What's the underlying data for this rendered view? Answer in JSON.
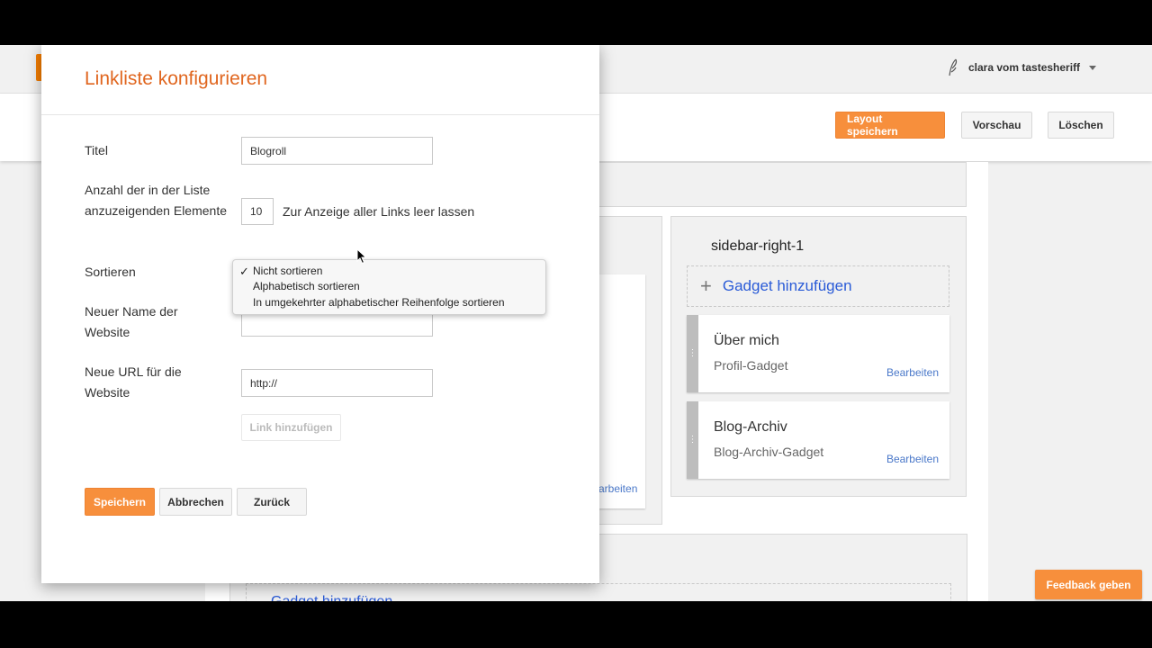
{
  "topbar": {
    "account_name": "clara vom tastesheriff",
    "account_icon": "quill-icon"
  },
  "header": {
    "save_layout_label": "Layout speichern",
    "preview_label": "Vorschau",
    "delete_label": "Löschen"
  },
  "sidebar_panel": {
    "title": "sidebar-right-1",
    "add_gadget_label": "Gadget hinzufügen",
    "gadgets": [
      {
        "title": "Über mich",
        "subtitle": "Profil-Gadget",
        "edit_label": "Bearbeiten"
      },
      {
        "title": "Blog-Archiv",
        "subtitle": "Blog-Archiv-Gadget",
        "edit_label": "Bearbeiten"
      }
    ]
  },
  "background": {
    "left_edit_partial": "arbeiten",
    "bottom_add_gadget_label": "Gadget hinzufügen"
  },
  "feedback_label": "Feedback geben",
  "dialog": {
    "title": "Linkliste konfigurieren",
    "title_label": "Titel",
    "title_value": "Blogroll",
    "count_label": "Anzahl der in der Liste anzuzeigenden Elemente",
    "count_value": "10",
    "count_hint": "Zur Anzeige aller Links leer lassen",
    "sort_label": "Sortieren",
    "sort_options": [
      "Nicht sortieren",
      "Alphabetisch sortieren",
      "In umgekehrter alphabetischer Reihenfolge sortieren"
    ],
    "sort_selected": "Nicht sortieren",
    "new_name_label": "Neuer Name der Website",
    "new_name_value": "",
    "new_url_label": "Neue URL für die Website",
    "new_url_value": "http://",
    "add_link_label": "Link hinzufügen",
    "save_label": "Speichern",
    "cancel_label": "Abbrechen",
    "back_label": "Zurück"
  },
  "colors": {
    "accent_orange": "#f78f3c",
    "title_orange": "#e0661f",
    "link_blue": "#2a5bd7"
  }
}
